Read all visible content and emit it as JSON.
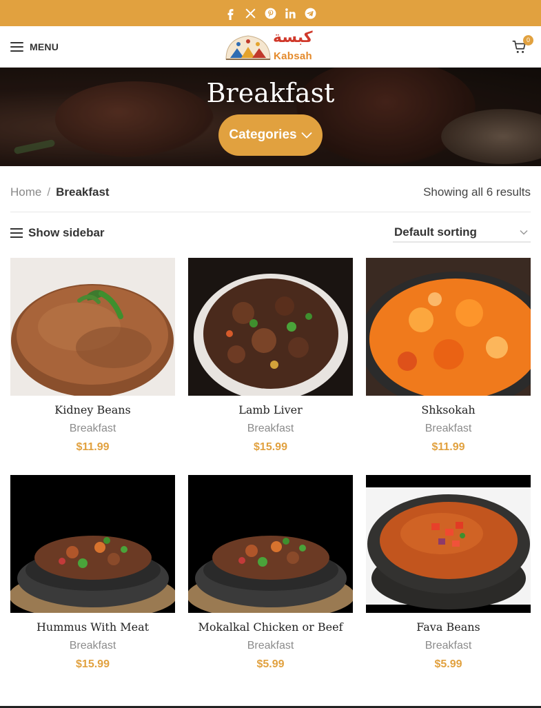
{
  "topbar": {
    "social": [
      {
        "name": "facebook-icon"
      },
      {
        "name": "x-twitter-icon"
      },
      {
        "name": "pinterest-icon"
      },
      {
        "name": "linkedin-icon"
      },
      {
        "name": "telegram-icon"
      }
    ],
    "background": "#e1a13f"
  },
  "header": {
    "menu_label": "MENU",
    "logo_text": "Kabsah",
    "logo_arabic": "كبسة",
    "cart_count": "0"
  },
  "hero": {
    "title": "Breakfast",
    "categories_label": "Categories"
  },
  "breadcrumb": {
    "home": "Home",
    "separator": "/",
    "current": "Breakfast"
  },
  "results_text": "Showing all 6 results",
  "toolbar": {
    "sidebar_label": "Show sidebar",
    "sort_selected": "Default sorting"
  },
  "products": [
    {
      "name": "Kidney Beans",
      "category": "Breakfast",
      "price": "$11.99"
    },
    {
      "name": "Lamb Liver",
      "category": "Breakfast",
      "price": "$15.99"
    },
    {
      "name": "Shksokah",
      "category": "Breakfast",
      "price": "$11.99"
    },
    {
      "name": "Hummus With Meat",
      "category": "Breakfast",
      "price": "$15.99"
    },
    {
      "name": "Mokalkal Chicken or Beef",
      "category": "Breakfast",
      "price": "$5.99"
    },
    {
      "name": "Fava Beans",
      "category": "Breakfast",
      "price": "$5.99"
    }
  ],
  "colors": {
    "accent": "#e1a13f",
    "text": "#333333",
    "muted": "#8b8b8b"
  }
}
